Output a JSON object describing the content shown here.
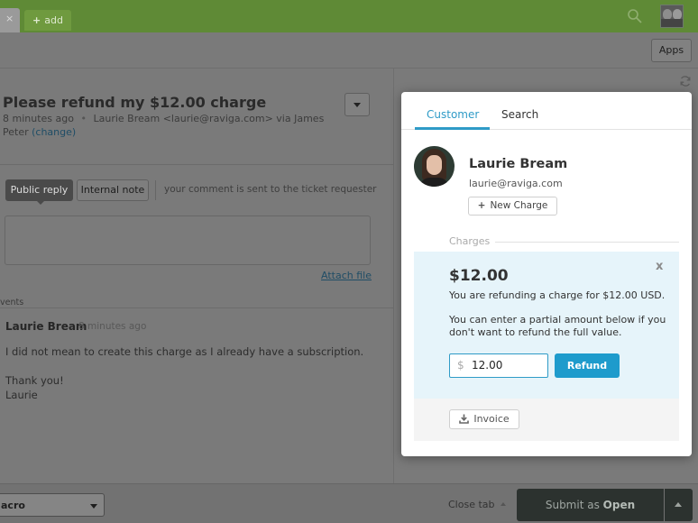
{
  "topbar": {
    "current_tab_close": "×",
    "add_tab_icon": "+",
    "add_tab_label": "add",
    "search_icon": "search-icon",
    "avatar_icon": "user-avatar"
  },
  "subbar": {
    "apps_label": "Apps"
  },
  "ticket": {
    "title": "Please refund my $12.00 charge",
    "time": "8 minutes ago",
    "bullet": "•",
    "requester": "Laurie Bream <laurie@raviga.com> via James Peter",
    "change_link": "(change)"
  },
  "composer": {
    "public_reply": "Public reply",
    "internal_note": "Internal note",
    "hint": "your comment is sent to the ticket requester",
    "attach_file": "Attach file"
  },
  "events": {
    "label": "vents",
    "items": [
      {
        "author": "Laurie Bream",
        "time": "8 minutes ago",
        "line1": "I did not mean to create this charge as I already have a subscription.",
        "line2": "Thank you!",
        "line3": "Laurie"
      }
    ]
  },
  "bottombar": {
    "macro_label": "acro",
    "close_tab": "Close tab",
    "submit_prefix": "Submit as ",
    "submit_status": "Open"
  },
  "panel": {
    "tabs": [
      "Customer",
      "Search"
    ],
    "customer": {
      "name": "Laurie Bream",
      "email": "laurie@raviga.com",
      "new_charge_icon": "+",
      "new_charge": "New Charge"
    },
    "charges_label": "Charges",
    "refund": {
      "amount": "$12.00",
      "close": "x",
      "text1": "You are refunding a charge for $12.00 USD.",
      "text2": "You can enter a partial amount below if you don't want to refund the full value.",
      "currency": "$",
      "input_value": "12.00",
      "button": "Refund"
    },
    "invoice_label": "Invoice"
  },
  "colors": {
    "topbar": "#5f8a36",
    "accent": "#2f9bc7",
    "refund_button": "#1e9bcc",
    "refund_bg": "#e6f4fa",
    "submit_bg": "#2c322f"
  }
}
